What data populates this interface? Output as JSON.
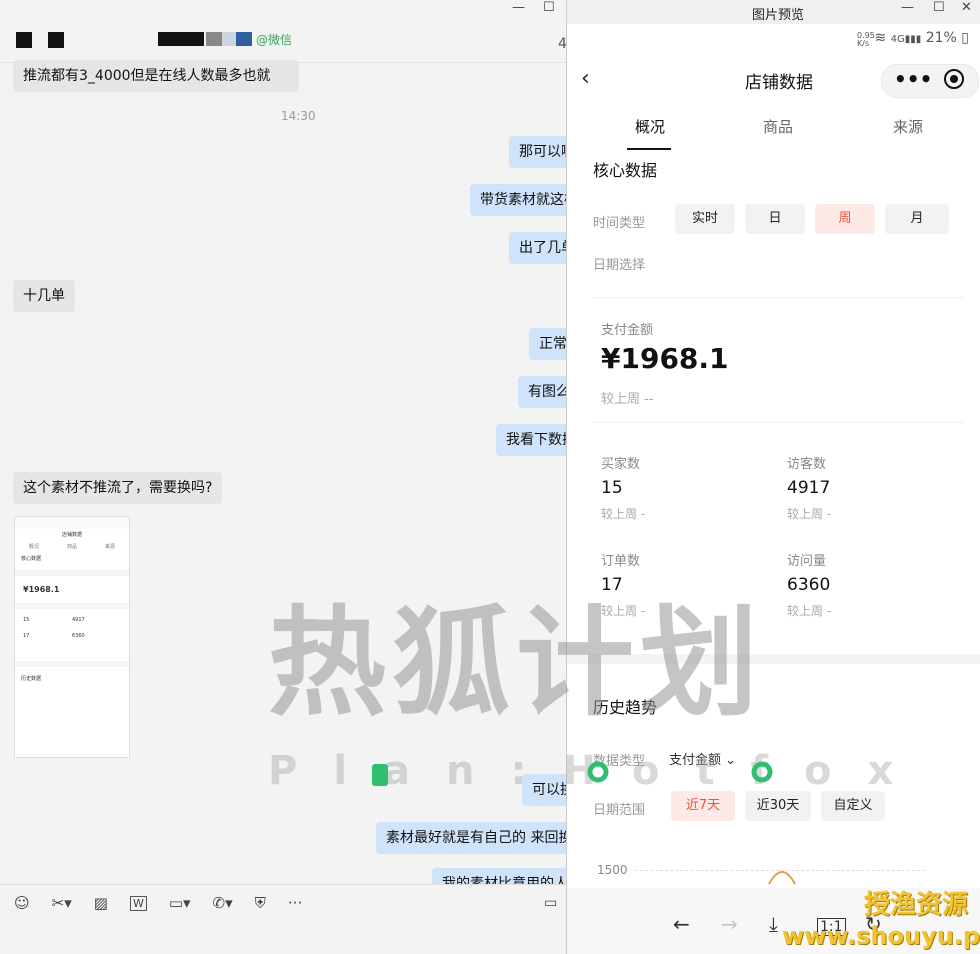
{
  "chat": {
    "contact_tag": "@微信",
    "side_digit": "4",
    "timestamp": "14:30",
    "messages": [
      {
        "dir": "in",
        "text": "推流都有3_4000但是在线人数最多也就"
      },
      {
        "dir": "out",
        "text": "那可以啊"
      },
      {
        "dir": "out",
        "text": "带货素材就这样"
      },
      {
        "dir": "out",
        "text": "出了几单"
      },
      {
        "dir": "in",
        "text": "十几单"
      },
      {
        "dir": "out",
        "text": "正常"
      },
      {
        "dir": "out",
        "text": "有图么"
      },
      {
        "dir": "out",
        "text": "我看下数据"
      },
      {
        "dir": "in",
        "text": "这个素材不推流了，需要换吗?"
      },
      {
        "dir": "out",
        "text": "可以换"
      },
      {
        "dir": "out",
        "text": "素材最好就是有自己的 来回换着"
      },
      {
        "dir": "out",
        "text": "我的素材比意用的人多"
      }
    ],
    "thumbnail": {
      "title": "店铺数据",
      "tabs": [
        "概况",
        "商品",
        "来源"
      ],
      "section": "核心数据",
      "amount": "¥1968.1",
      "stats": [
        "15",
        "4917",
        "17",
        "6360"
      ],
      "history": "历史数据"
    },
    "toolbar_icons": [
      "emoji-icon",
      "scissors-icon",
      "image-icon",
      "word-doc-icon",
      "folder-icon",
      "phone-icon",
      "shield-icon",
      "more-icon"
    ]
  },
  "viewer": {
    "window_title": "图片预览",
    "status": {
      "speed_top": "0.95",
      "speed_unit": "K/s",
      "battery": "21%"
    },
    "header_title": "店铺数据",
    "tabs": [
      "概况",
      "商品",
      "来源"
    ],
    "active_tab": 0,
    "core": {
      "title": "核心数据",
      "time_type_label": "时间类型",
      "time_types": [
        "实时",
        "日",
        "周",
        "月"
      ],
      "selected_time_type": 2,
      "date_label": "日期选择"
    },
    "payment": {
      "label": "支付金额",
      "value": "¥1968.1",
      "compare": "较上周 --"
    },
    "metrics": [
      {
        "label": "买家数",
        "value": "15",
        "compare": "较上周 -"
      },
      {
        "label": "访客数",
        "value": "4917",
        "compare": "较上周 -"
      },
      {
        "label": "订单数",
        "value": "17",
        "compare": "较上周 -"
      },
      {
        "label": "访问量",
        "value": "6360",
        "compare": "较上周 -"
      }
    ],
    "history": {
      "title": "历史趋势",
      "data_type_label": "数据类型",
      "data_type_value": "支付金额",
      "range_label": "日期范围",
      "ranges": [
        "近7天",
        "近30天",
        "自定义"
      ],
      "selected_range": 0,
      "chart_y_tick": "1500"
    }
  },
  "watermarks": {
    "main": "热狐计划",
    "sub": "Plan:Hotfox",
    "site_name": "授渔资源",
    "site_url": "www.shouyu.pw"
  }
}
